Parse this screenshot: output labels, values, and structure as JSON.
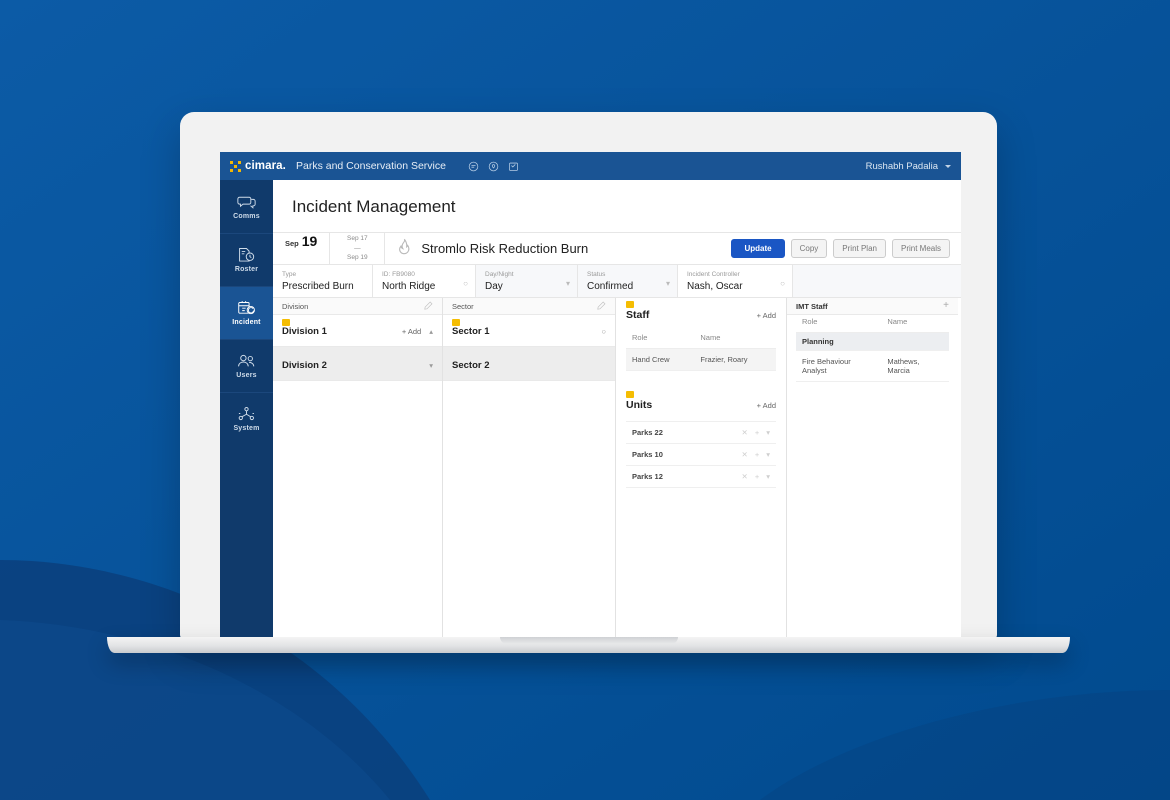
{
  "brand": {
    "logo_word": "cimara.",
    "org_name": "Parks and Conservation Service"
  },
  "topbar": {
    "icons": [
      {
        "name": "chat-icon",
        "label": "Comms"
      },
      {
        "name": "location-pin-icon",
        "label": "Location"
      },
      {
        "name": "calendar-check-icon",
        "label": "Tasks"
      }
    ],
    "user_name": "Rushabh Padalia"
  },
  "sidebar": {
    "items": [
      {
        "label": "Comms",
        "icon": "chat-bubbles-icon",
        "active": false
      },
      {
        "label": "Roster",
        "icon": "roster-clock-icon",
        "active": false
      },
      {
        "label": "Incident",
        "icon": "incident-calendar-icon",
        "active": true
      },
      {
        "label": "Users",
        "icon": "users-icon",
        "active": false
      },
      {
        "label": "System",
        "icon": "system-nodes-icon",
        "active": false
      }
    ]
  },
  "page": {
    "title": "Incident Management"
  },
  "incident_bar": {
    "date_month": "Sep",
    "date_day": "19",
    "range_start": "Sep 17",
    "range_dash": "—",
    "range_end": "Sep 19",
    "incident_icon": "flame-icon",
    "incident_name": "Stromlo Risk Reduction Burn",
    "buttons": [
      {
        "label": "Update",
        "primary": true
      },
      {
        "label": "Copy",
        "primary": false
      },
      {
        "label": "Print Plan",
        "primary": false
      },
      {
        "label": "Print Meals",
        "primary": false
      }
    ]
  },
  "meta_fields": [
    {
      "key": "Type",
      "value": "Prescribed Burn",
      "adorn": ""
    },
    {
      "key": "ID: FB9080",
      "value": "North Ridge",
      "adorn": "refresh"
    },
    {
      "key": "Day/Night",
      "value": "Day",
      "adorn": "caret"
    },
    {
      "key": "Status",
      "value": "Confirmed",
      "adorn": "caret"
    },
    {
      "key": "Incident Controller",
      "value": "Nash, Oscar",
      "adorn": "refresh"
    }
  ],
  "division_column": {
    "header": "Division",
    "header_icon": "pencil-icon",
    "nodes": [
      {
        "name": "Division 1",
        "tagged": true,
        "add_label": "+ Add",
        "caret": "up",
        "selected": false
      },
      {
        "name": "Division 2",
        "tagged": false,
        "add_label": "",
        "caret": "down",
        "selected": true
      }
    ]
  },
  "sector_column": {
    "header": "Sector",
    "header_icon": "pencil-icon",
    "nodes": [
      {
        "name": "Sector 1",
        "tagged": true,
        "caret": "circle",
        "selected": false
      },
      {
        "name": "Sector 2",
        "tagged": false,
        "caret": "",
        "selected": true
      }
    ]
  },
  "staff_panel": {
    "tagged": true,
    "title": "Staff",
    "add_label": "+ Add",
    "columns": [
      "Role",
      "Name"
    ],
    "rows": [
      {
        "role": "Hand Crew",
        "name": "Frazier, Roary"
      }
    ]
  },
  "units_panel": {
    "tagged": true,
    "title": "Units",
    "add_label": "+ Add",
    "rows": [
      {
        "name": "Parks 22"
      },
      {
        "name": "Parks 10"
      },
      {
        "name": "Parks 12"
      }
    ],
    "row_icons": [
      "close-icon",
      "plus-icon",
      "chevron-down-icon"
    ]
  },
  "imt_panel": {
    "title": "IMT Staff",
    "add_icon": "plus-icon",
    "columns": [
      "Role",
      "Name"
    ],
    "groups": [
      {
        "group": "Planning",
        "rows": [
          {
            "role": "Fire Behaviour Analyst",
            "name": "Mathews, Marcia"
          }
        ]
      }
    ]
  },
  "colors": {
    "page_background": "#0158a2",
    "background_wave": "#0b3f7d",
    "topbar": "#1a5494",
    "sidebar": "#103a6b",
    "sidebar_active": "#1a5494",
    "primary_button": "#1a56c4",
    "tag_yellow": "#f5bd02",
    "logo_mark": "#f2b705"
  }
}
